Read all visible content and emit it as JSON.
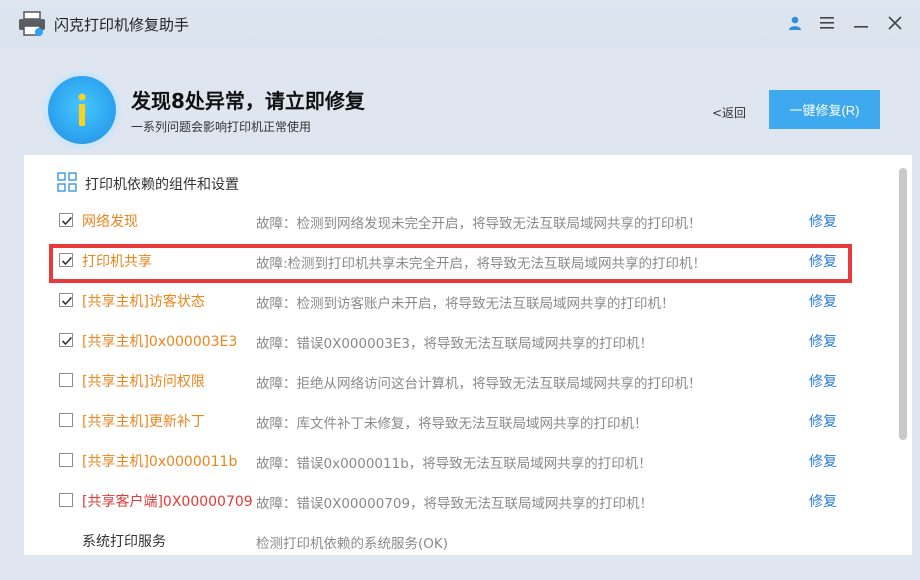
{
  "window": {
    "title": "闪克打印机修复助手"
  },
  "header": {
    "headline": "发现8处异常，请立即修复",
    "subline": "一系列问题会影响打印机正常使用",
    "back_label": "<返回",
    "fix_all_label": "一键修复(R)"
  },
  "section": {
    "title": "打印机依赖的组件和设置"
  },
  "items": [
    {
      "name": "网络发现",
      "desc": "故障：检测到网络发现未完全开启，将导致无法互联局域网共享的打印机！",
      "fix": "修复",
      "checked": true,
      "color": "#e8861c"
    },
    {
      "name": "打印机共享",
      "desc": "故障:检测到打印机共享未完全开启，将导致无法互联局域网共享的打印机！",
      "fix": "修复",
      "checked": true,
      "color": "#e8861c"
    },
    {
      "name": "[共享主机]访客状态",
      "desc": "故障：检测到访客账户未开启，将导致无法互联局域网共享的打印机！",
      "fix": "修复",
      "checked": true,
      "color": "#e8861c"
    },
    {
      "name": "[共享主机]0x000003E3",
      "desc": "故障：错误0X000003E3，将导致无法互联局域网共享的打印机！",
      "fix": "修复",
      "checked": true,
      "color": "#e8861c"
    },
    {
      "name": "[共享主机]访问权限",
      "desc": "故障：拒绝从网络访问这台计算机，将导致无法互联局域网共享的打印机！",
      "fix": "修复",
      "checked": false,
      "color": "#e8861c"
    },
    {
      "name": "[共享主机]更新补丁",
      "desc": "故障：库文件补丁未修复，将导致无法互联局域网共享的打印机！",
      "fix": "修复",
      "checked": false,
      "color": "#e8861c"
    },
    {
      "name": "[共享主机]0x0000011b",
      "desc": "故障：错误0x0000011b，将导致无法互联局域网共享的打印机！",
      "fix": "修复",
      "checked": false,
      "color": "#e8861c"
    },
    {
      "name": "[共享客户端]0X00000709",
      "desc": "故障：错误0X00000709，将导致无法互联局域网共享的打印机！",
      "fix": "修复",
      "checked": false,
      "color": "#e53935"
    },
    {
      "name": "系统打印服务",
      "desc": "检测打印机依赖的系统服务(OK)",
      "fix": "",
      "checked": null,
      "color": "#333333"
    }
  ],
  "colors": {
    "accent_blue": "#3ea9ef",
    "link_blue": "#2b7bd6",
    "warning_orange": "#e8861c",
    "error_red": "#e53935",
    "highlight_red": "#e83a3a"
  }
}
